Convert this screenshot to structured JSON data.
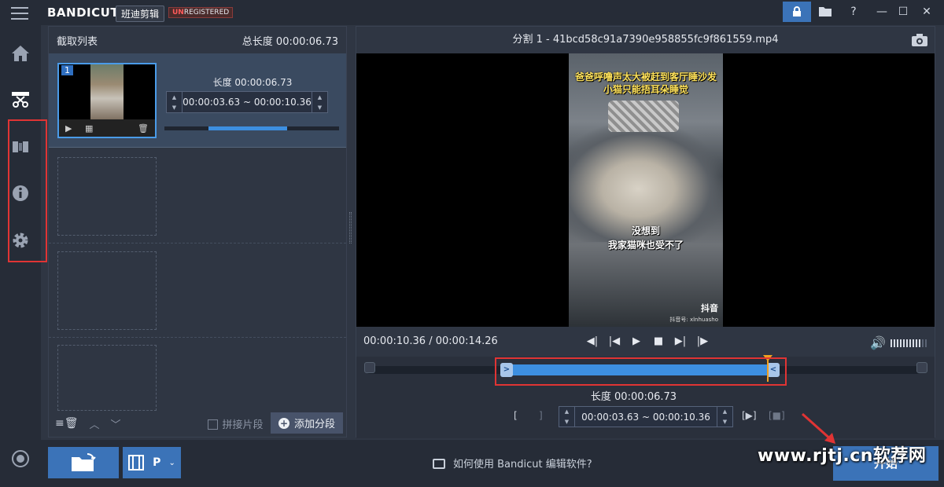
{
  "titlebar": {
    "brand": "BANDICUT",
    "brand_cn": "班迪剪辑",
    "unreg_prefix": "UN",
    "unreg_rest": "REGISTERED",
    "buttons": [
      "lock-icon",
      "folder-icon",
      "help-icon",
      "minimize-icon",
      "maximize-icon",
      "close-icon"
    ],
    "help_label": "?",
    "minimize_label": "—",
    "maximize_label": "☐",
    "close_label": "✕"
  },
  "nav": {
    "items": [
      "home-icon",
      "cut-icon",
      "join-icon",
      "info-icon",
      "settings-icon"
    ],
    "bottom": "record-icon"
  },
  "cut_list": {
    "title": "截取列表",
    "total_length": "总长度 00:00:06.73",
    "segments": [
      {
        "number": "1",
        "length": "长度 00:00:06.73",
        "start": "00:00:03.63",
        "separator": "~",
        "end": "00:00:10.36",
        "progress": 0.45
      }
    ],
    "merge_label": "拼接片段",
    "add_label": "添加分段"
  },
  "player": {
    "title": "分割 1 - 41bcd58c91a7390e958855fc9f861559.mp4",
    "captions_top": [
      "爸爸呼噜声太大被赶到客厅睡沙发",
      "小猫只能捂耳朵睡觉"
    ],
    "captions_mid": [
      "没想到",
      "我家猫咪也受不了"
    ],
    "tiktok": "抖音",
    "tiktok_id": "抖音号: xlnhuasho",
    "time": "00:00:10.36 / 00:00:14.26",
    "volume_level": 0.8
  },
  "timeline": {
    "length": "长度 00:00:06.73",
    "start": "00:00:03.63",
    "separator": "~",
    "end": "00:00:10.36",
    "bracket_open": "[",
    "bracket_close": "]",
    "play_bracket": "[▶]"
  },
  "bottom": {
    "help_text": "如何使用 Bandicut 编辑软件?",
    "start_label": "开始",
    "mode_label": "P",
    "watermark": "www.rjtj.cn软荐网"
  },
  "colors": {
    "accent": "#3b73b8",
    "selection": "#3d8fe0",
    "highlight": "#e03434",
    "playhead": "#f0a020"
  }
}
